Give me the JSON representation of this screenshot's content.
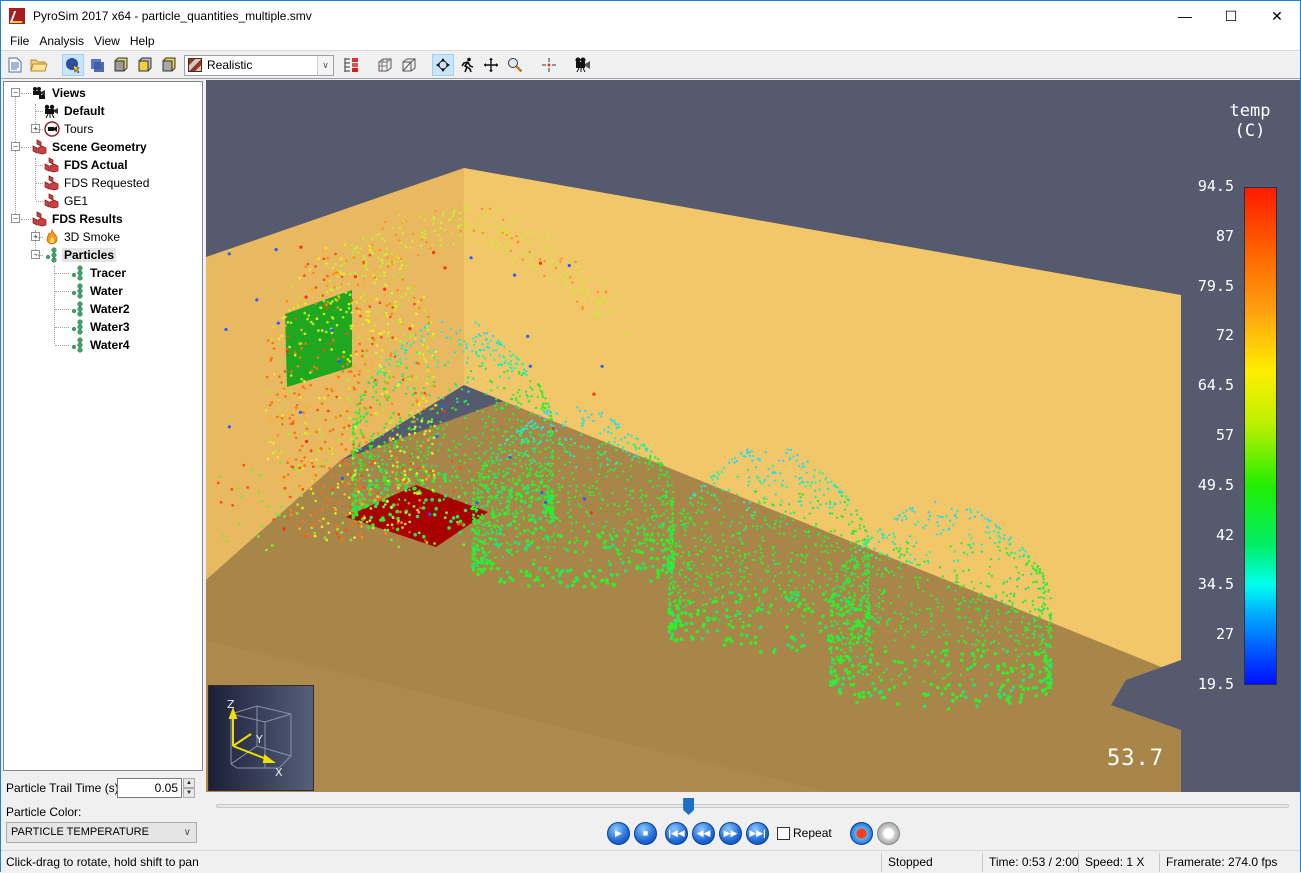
{
  "window": {
    "title": "PyroSim 2017 x64 - particle_quantities_multiple.smv",
    "controls": {
      "minimize": "—",
      "maximize": "☐",
      "close": "✕"
    }
  },
  "menu": [
    {
      "label": "File",
      "accel": "F"
    },
    {
      "label": "Analysis",
      "accel": "n"
    },
    {
      "label": "View",
      "accel": "V"
    },
    {
      "label": "Help",
      "accel": "H"
    }
  ],
  "toolbar": {
    "buttons": [
      "new-file-icon",
      "open-folder-icon",
      "select-object-icon",
      "show-objects-icon",
      "view-front-icon",
      "view-top-icon",
      "view-side-icon"
    ],
    "render_mode": {
      "selected": "Realistic"
    },
    "buttons_right": [
      "color-scale-icon",
      "solid-box-icon",
      "wireframe-box-icon",
      "orbit-icon",
      "walk-icon",
      "pan-icon",
      "zoom-icon",
      "recenter-icon",
      "camera-icon"
    ],
    "active": [
      "select-object-icon",
      "orbit-icon"
    ]
  },
  "tree": {
    "items": [
      {
        "label": "Views",
        "bold": true,
        "depth": 0,
        "icon": "camera-group-icon",
        "expander": "−"
      },
      {
        "label": "Default",
        "bold": true,
        "depth": 1,
        "icon": "camera-icon"
      },
      {
        "label": "Tours",
        "bold": false,
        "depth": 1,
        "icon": "tour-icon",
        "expander": "+"
      },
      {
        "label": "Scene Geometry",
        "bold": true,
        "depth": 0,
        "icon": "geometry-icon",
        "expander": "−"
      },
      {
        "label": "FDS Actual",
        "bold": true,
        "depth": 1,
        "icon": "geometry-icon"
      },
      {
        "label": "FDS Requested",
        "bold": false,
        "depth": 1,
        "icon": "geometry-icon"
      },
      {
        "label": "GE1",
        "bold": false,
        "depth": 1,
        "icon": "geometry-icon"
      },
      {
        "label": "FDS Results",
        "bold": true,
        "depth": 0,
        "icon": "geometry-icon",
        "expander": "−"
      },
      {
        "label": "3D Smoke",
        "bold": false,
        "depth": 1,
        "icon": "smoke-fire-icon",
        "expander": "+"
      },
      {
        "label": "Particles",
        "bold": true,
        "depth": 1,
        "icon": "particles-icon",
        "expander": "−",
        "selected": true
      },
      {
        "label": "Tracer",
        "bold": true,
        "depth": 2,
        "icon": "particles-icon"
      },
      {
        "label": "Water",
        "bold": true,
        "depth": 2,
        "icon": "particles-icon"
      },
      {
        "label": "Water2",
        "bold": true,
        "depth": 2,
        "icon": "particles-icon"
      },
      {
        "label": "Water3",
        "bold": true,
        "depth": 2,
        "icon": "particles-icon"
      },
      {
        "label": "Water4",
        "bold": true,
        "depth": 2,
        "icon": "particles-icon"
      }
    ]
  },
  "options": {
    "trail_time_label": "Particle Trail Time (s):",
    "trail_time_value": "0.05",
    "color_label": "Particle Color:",
    "color_selected": "PARTICLE TEMPERATURE"
  },
  "viewport": {
    "colorbar": {
      "title_line1": "temp",
      "title_line2": "(C)",
      "ticks": [
        "94.5",
        "87",
        "79.5",
        "72",
        "64.5",
        "57",
        "49.5",
        "42",
        "34.5",
        "27",
        "19.5"
      ],
      "min": 19.5,
      "max": 94.5
    },
    "time_readout": "53.7",
    "axes": {
      "x": "X",
      "y": "Y",
      "z": "Z"
    },
    "colors": {
      "background": "#555a6e",
      "wall": "#f2c76a",
      "floor": "#a8864a",
      "vent": "#1fa81f",
      "burner": "#a80000"
    }
  },
  "playback": {
    "progress": 0.44,
    "buttons": [
      "play",
      "stop",
      "skip-to-start",
      "step-back",
      "step-forward",
      "skip-to-end"
    ],
    "repeat_label": "Repeat",
    "repeat_checked": false
  },
  "status": {
    "hint": "Click-drag to rotate, hold shift to pan",
    "state": "Stopped",
    "time": "Time: 0:53 / 2:00",
    "speed": "Speed: 1 X",
    "framerate": "Framerate: 274.0 fps"
  }
}
